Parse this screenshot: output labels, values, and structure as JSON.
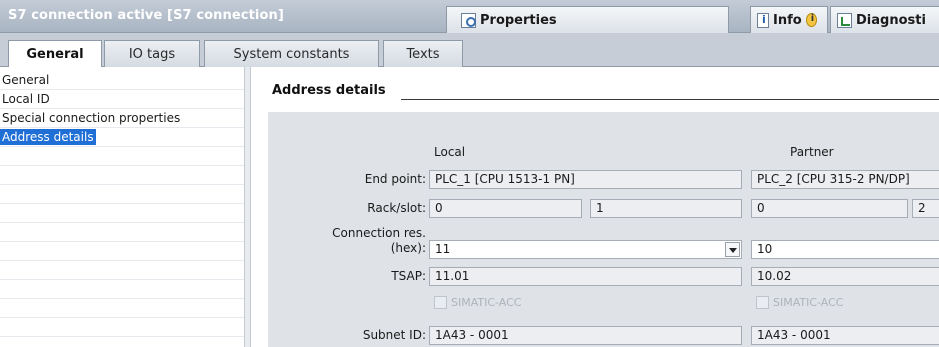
{
  "titlebar": {
    "title": "S7 connection active [S7 connection]",
    "tabs": [
      {
        "label": "Properties",
        "icon": "properties-icon"
      },
      {
        "label": "Info",
        "icon": "info-icon"
      },
      {
        "label": "Diagnosti",
        "icon": "diagnostics-icon"
      }
    ]
  },
  "section_tabs": [
    "General",
    "IO tags",
    "System constants",
    "Texts"
  ],
  "nav": {
    "items": [
      "General",
      "Local ID",
      "Special connection properties",
      "Address details"
    ],
    "selected": "Address details"
  },
  "content": {
    "section_title": "Address details",
    "columns": {
      "local": "Local",
      "partner": "Partner"
    },
    "rows": {
      "end_point": {
        "label": "End point:",
        "local": "PLC_1 [CPU 1513-1 PN]",
        "partner": "PLC_2 [CPU 315-2 PN/DP]"
      },
      "rack_slot": {
        "label": "Rack/slot:",
        "local_rack": "0",
        "local_slot": "1",
        "partner_rack": "0",
        "partner_slot": "2"
      },
      "connection_res": {
        "label_line1": "Connection res.",
        "label_line2": "(hex):",
        "local": "11",
        "partner": "10"
      },
      "tsap": {
        "label": "TSAP:",
        "local": "11.01",
        "partner": "10.02"
      },
      "simatic_acc": {
        "local": "SIMATIC-ACC",
        "partner": "SIMATIC-ACC",
        "local_checked": false,
        "partner_checked": false
      },
      "subnet_id": {
        "label": "Subnet ID:",
        "local": "1A43 - 0001",
        "partner": "1A43 - 0001"
      }
    }
  },
  "colors": {
    "selection": "#1f6fd6",
    "titlebar_text": "#ffffff",
    "panel_bg": "#dfe3e8"
  }
}
